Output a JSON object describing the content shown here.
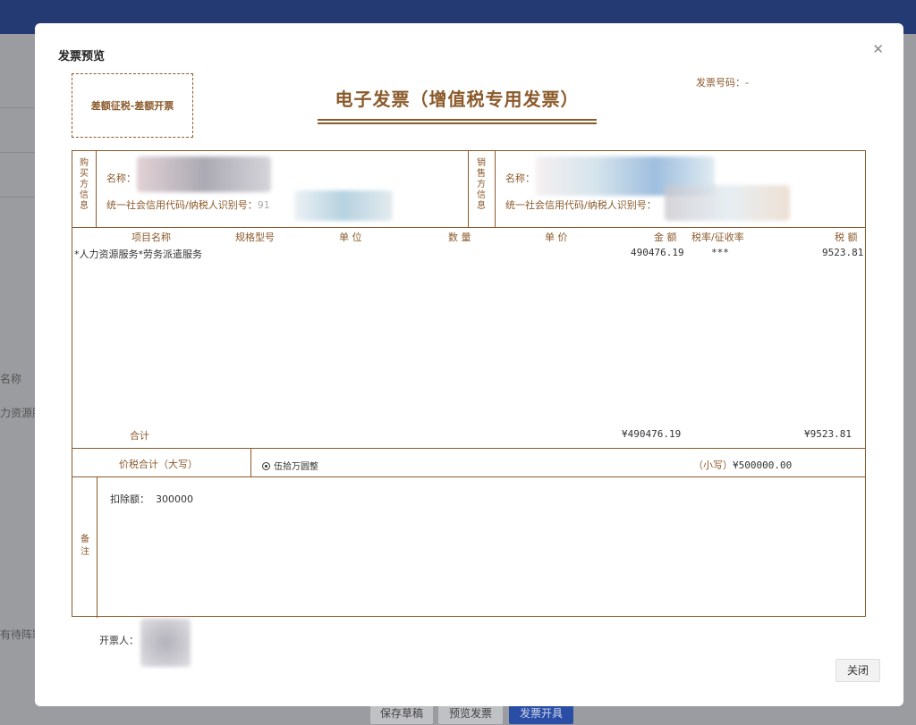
{
  "background": {
    "fragments": [
      "名称",
      "力资源服",
      "有待阵罪"
    ],
    "buttons": [
      "保存草稿",
      "预览发票",
      "发票开具"
    ]
  },
  "modal": {
    "title": "发票预览",
    "close_icon": "close-icon"
  },
  "invoice": {
    "stamp": "差额征税-差额开票",
    "title": "电子发票（增值税专用发票）",
    "invoice_no_label": "发票号码：",
    "invoice_no_value": "-",
    "buyer": {
      "side_label": "购买方信息",
      "name_label": "名称：",
      "tax_id_label": "统一社会信用代码/纳税人识别号：",
      "tax_id_partial": "91"
    },
    "seller": {
      "side_label": "销售方信息",
      "name_label": "名称：",
      "tax_id_label": "统一社会信用代码/纳税人识别号："
    },
    "columns": [
      "项目名称",
      "规格型号",
      "单 位",
      "数 量",
      "单 价",
      "金 额",
      "税率/征收率",
      "税 额"
    ],
    "items": [
      {
        "name": "*人力资源服务*劳务派遣服务",
        "amount": "490476.19",
        "tax_rate": "***",
        "tax": "9523.81"
      }
    ],
    "total_label": "合计",
    "total_amount": "¥490476.19",
    "total_tax": "¥9523.81",
    "price_tax_total_label": "价税合计（大写）",
    "price_tax_total_upper": "伍拾万圆整",
    "price_tax_total_lower_label": "（小写）",
    "price_tax_total_lower_value": "¥500000.00",
    "remark_label": "备注",
    "remark_text": "扣除额：  300000",
    "issuer_label": "开票人："
  },
  "footer": {
    "close_label": "关闭"
  },
  "colors": {
    "invoice_brown": "#8b5a2b",
    "topbar_navy": "#233a73",
    "primary_blue": "#2a4ea6"
  }
}
